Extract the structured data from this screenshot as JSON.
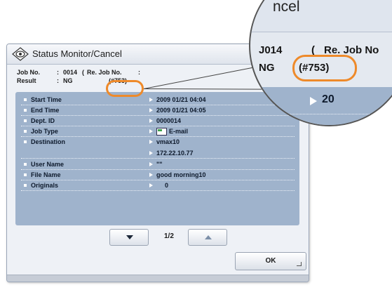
{
  "window": {
    "title": "Status Monitor/Cancel"
  },
  "job_header": {
    "job_no_label": "Job No.",
    "job_no_colon": ":",
    "job_no_value": "0014",
    "result_label": "Result",
    "result_colon": ":",
    "result_value": "NG",
    "re_open": "(",
    "re_label": "Re. Job No.",
    "re_colon": ":",
    "re_value": "(#753)"
  },
  "details": [
    {
      "label": "Start Time",
      "value": "2009 01/21 04:04"
    },
    {
      "label": "End Time",
      "value": "2009 01/21 04:05"
    },
    {
      "label": "Dept. ID",
      "value": "0000014"
    },
    {
      "label": "Job Type",
      "value": "E-mail",
      "icon": "email-icon"
    },
    {
      "label": "Destination",
      "value": "vmax10"
    },
    {
      "label": "",
      "value": "172.22.10.77"
    },
    {
      "label": "User Name",
      "value": "\"\""
    },
    {
      "label": "File Name",
      "value": "good morning10"
    },
    {
      "label": "Originals",
      "value": "0"
    }
  ],
  "pager": {
    "page_text": "1/2"
  },
  "ok_label": "OK",
  "magnifier": {
    "title_fragment": "ncel",
    "job_fragment": "J014",
    "re_open": "(",
    "re_fragment": "Re. Job No",
    "result_value": "NG",
    "re_value": "(#753)",
    "time_fragment": "20"
  },
  "colors": {
    "highlight": "#ee8a2a",
    "detail_bg": "#9fb3cc"
  }
}
